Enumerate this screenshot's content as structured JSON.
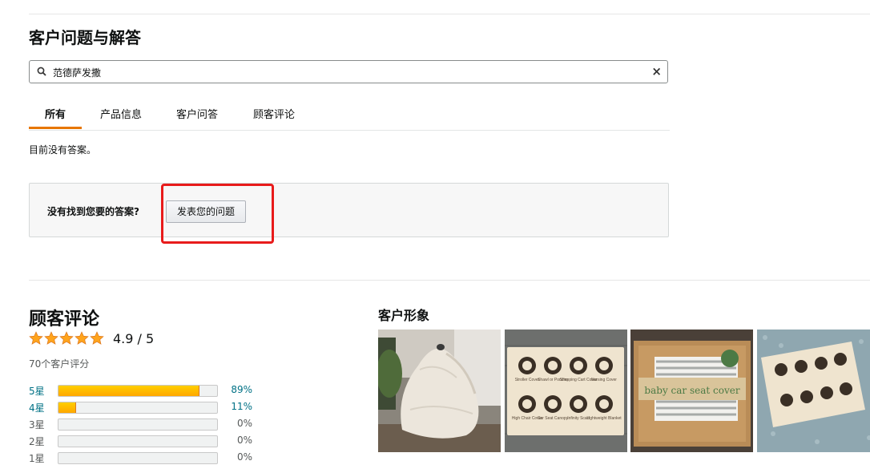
{
  "qa": {
    "title": "客户问题与解答",
    "search": {
      "value": "范德萨发撒",
      "clear_glyph": "×"
    },
    "tabs": [
      {
        "label": "所有",
        "active": true
      },
      {
        "label": "产品信息",
        "active": false
      },
      {
        "label": "客户问答",
        "active": false
      },
      {
        "label": "顾客评论",
        "active": false
      }
    ],
    "no_answer_text": "目前没有答案。",
    "ask_prompt": "没有找到您要的答案?",
    "ask_button_label": "发表您的问题"
  },
  "reviews": {
    "title": "顾客评论",
    "stars": 4.9,
    "rating_text": "4.9 / 5",
    "count_text": "70个客户评分",
    "histogram": [
      {
        "label": "5星",
        "percent_text": "89%",
        "percent": 89,
        "link": true
      },
      {
        "label": "4星",
        "percent_text": "11%",
        "percent": 11,
        "link": true
      },
      {
        "label": "3星",
        "percent_text": "0%",
        "percent": 0,
        "link": false
      },
      {
        "label": "2星",
        "percent_text": "0%",
        "percent": 0,
        "link": false
      },
      {
        "label": "1星",
        "percent_text": "0%",
        "percent": 0,
        "link": false
      }
    ]
  },
  "customer_images": {
    "title": "客户形象",
    "thumbnails": [
      {
        "name": "customer-photo-1"
      },
      {
        "name": "customer-photo-2",
        "labels": [
          "Stroller Cover",
          "Shawl or Poncho",
          "Shopping Cart Cover",
          "Nursing Cover",
          "High Chair Cover",
          "Car Seat Canopy",
          "Infinity Scarf",
          "Lightweight Blanket"
        ]
      },
      {
        "name": "customer-photo-3",
        "text": "baby car seat cover"
      },
      {
        "name": "customer-photo-4"
      }
    ]
  },
  "colors": {
    "accent": "#e77600",
    "link": "#007185",
    "star": "#ffa41c",
    "highlight_box": "#e81b1b"
  }
}
